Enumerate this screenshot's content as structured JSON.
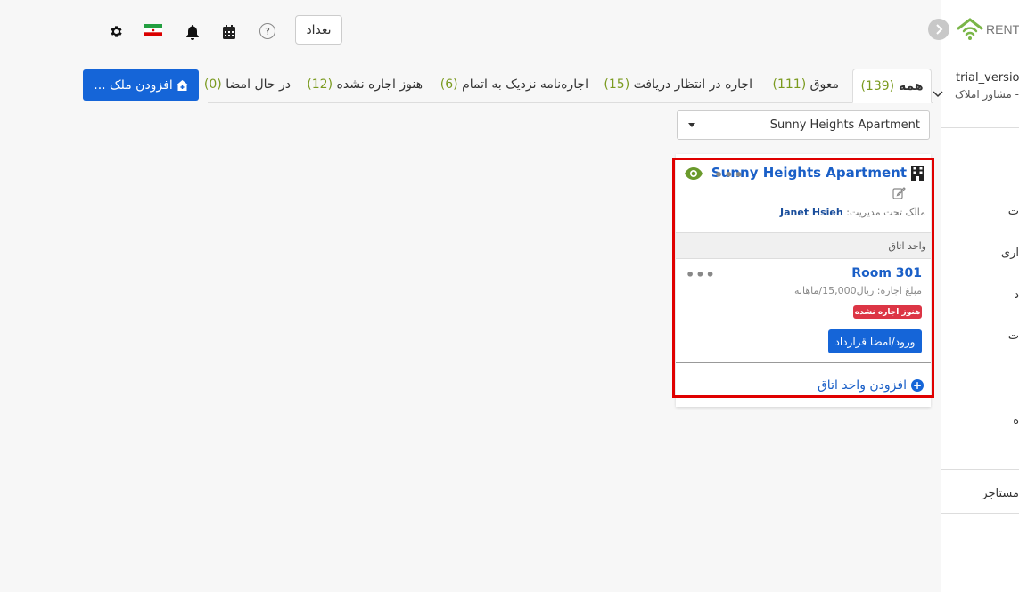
{
  "header": {
    "count_button": "تعداد",
    "help_glyph": "?"
  },
  "sidebar": {
    "logo_text": "RENT",
    "user_name": "trial_version",
    "user_role": "- مشاور املاک",
    "menu_fragments": [
      "ت",
      "اری",
      "د",
      "ت",
      "",
      "ه"
    ],
    "bottom_item": "مستاجر"
  },
  "tabs": {
    "all": {
      "label": "همه",
      "count": "(139)"
    },
    "overdue": {
      "label": "معوق",
      "count": "(111)"
    },
    "pending_rent": {
      "label": "اجاره در انتظار دریافت",
      "count": "(15)"
    },
    "expiring": {
      "label": "اجاره‌نامه نزدیک به اتمام",
      "count": "(6)"
    },
    "not_rented": {
      "label": "هنوز اجاره نشده",
      "count": "(12)"
    },
    "signing": {
      "label": "در حال امضا",
      "count": "(0)"
    }
  },
  "add_property_label": "افزودن ملک ...",
  "property_select": {
    "value": "Sunny Heights Apartment"
  },
  "property_card": {
    "title": "Sunny Heights Apartment",
    "owner_label": "مالک تحت مدیریت:",
    "owner_name": "Janet Hsieh",
    "units_header": "واحد اتاق",
    "room": {
      "name": "Room 301",
      "rent": "مبلغ اجاره: ریال15,000/ماهانه",
      "status_badge": "هنوز اجاره نشده",
      "action_button": "ورود/امضا قرارداد"
    },
    "add_unit_label": "افزودن واحد اتاق"
  },
  "colors": {
    "primary": "#1565d8",
    "link": "#1a5fc7",
    "count_green": "#7a9a1e",
    "danger": "#dc3545",
    "highlight": "#e00000"
  }
}
